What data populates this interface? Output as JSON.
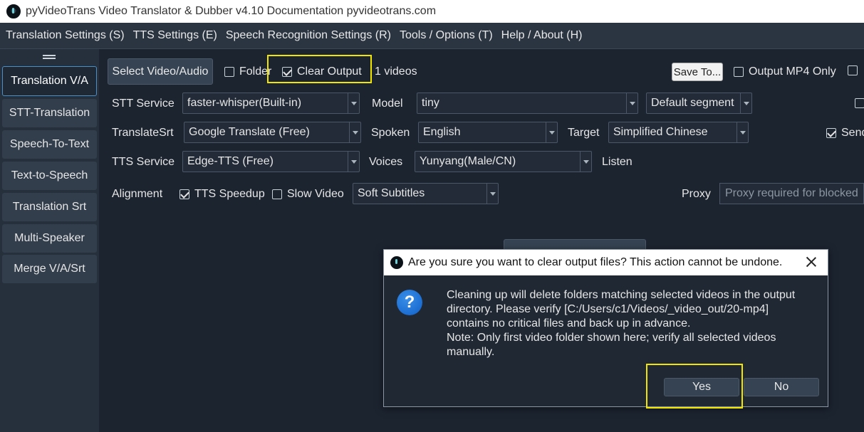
{
  "window": {
    "title": "pyVideoTrans Video Translator & Dubber v4.10 Documentation pyvideotrans.com"
  },
  "menu": [
    "Translation Settings (S)",
    "TTS Settings (E)",
    "Speech Recognition Settings (R)",
    "Tools / Options (T)",
    "Help / About (H)"
  ],
  "sidebar": {
    "items": [
      {
        "label": "Translation V/A",
        "active": true
      },
      {
        "label": "STT-Translation"
      },
      {
        "label": "Speech-To-Text"
      },
      {
        "label": "Text-to-Speech"
      },
      {
        "label": "Translation Srt"
      },
      {
        "label": "Multi-Speaker"
      },
      {
        "label": "Merge V/A/Srt"
      }
    ]
  },
  "toolbar": {
    "select_video": "Select Video/Audio",
    "folder": {
      "label": "Folder",
      "checked": false
    },
    "clear_output": {
      "label": "Clear Output",
      "checked": true
    },
    "video_count": "1 videos",
    "save_to": "Save To...",
    "output_mp4_only": {
      "label": "Output MP4 Only",
      "checked": false
    }
  },
  "row_stt": {
    "label": "STT Service",
    "value": "faster-whisper(Built-in)",
    "model_label": "Model",
    "model_value": "tiny",
    "segment_value": "Default segment"
  },
  "row_translate": {
    "label": "TranslateSrt",
    "value": "Google Translate (Free)",
    "spoken_label": "Spoken",
    "spoken_value": "English",
    "target_label": "Target",
    "target_value": "Simplified Chinese",
    "send_label": "Send",
    "send_checked": true
  },
  "row_tts": {
    "label": "TTS Service",
    "value": "Edge-TTS (Free)",
    "voices_label": "Voices",
    "voices_value": "Yunyang(Male/CN)",
    "listen_label": "Listen"
  },
  "row_align": {
    "label": "Alignment",
    "tts_speedup": {
      "label": "TTS Speedup",
      "checked": true
    },
    "slow_video": {
      "label": "Slow Video",
      "checked": false
    },
    "subtitle_value": "Soft Subtitles",
    "proxy_label": "Proxy",
    "proxy_placeholder": "Proxy required for blocked"
  },
  "dialog": {
    "title": "Are you sure you want to clear output files? This action cannot be undone.",
    "message_lines": [
      "Cleaning up will delete folders matching selected videos in the output",
      "directory. Please verify [C:/Users/c1/Videos/_video_out/20-mp4]",
      "contains no critical files and back up in advance.",
      "Note: Only first video folder shown here; verify all selected videos",
      "manually."
    ],
    "yes_label": "Yes",
    "no_label": "No",
    "icon": "question-icon"
  },
  "colors": {
    "highlight": "#f2e600",
    "accent": "#4b8fc8",
    "background": "#1c2430"
  }
}
